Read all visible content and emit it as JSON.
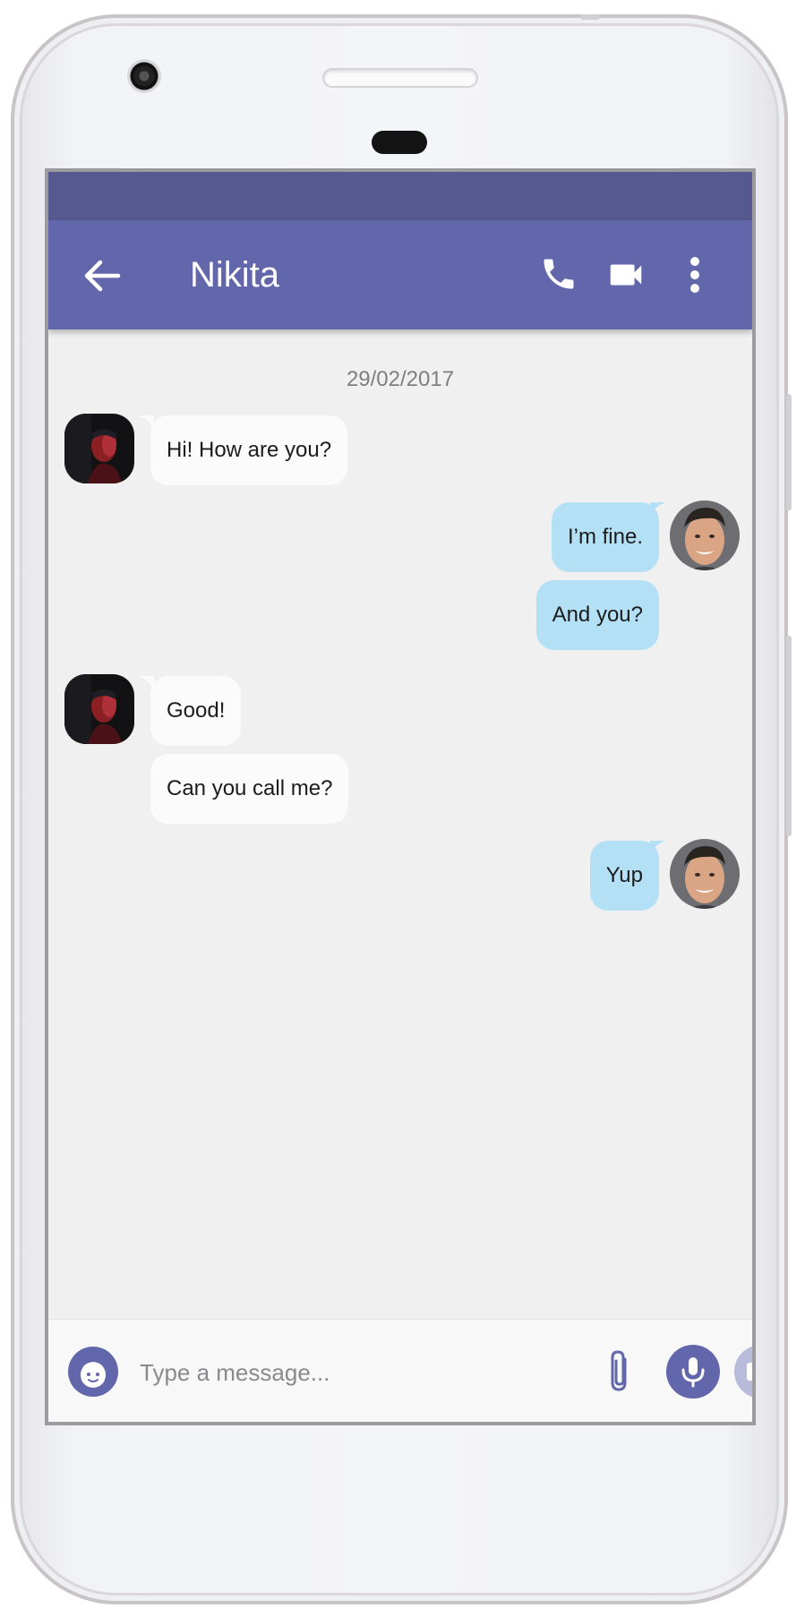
{
  "theme": {
    "status_bar_color": "#56598f",
    "app_bar_color": "#6266ab",
    "incoming_bubble_color": "#fbfbfb",
    "outgoing_bubble_color": "#b4e0f6",
    "chat_background": "#f0f0f1"
  },
  "header": {
    "title": "Nikita",
    "icons": [
      "back-arrow-icon",
      "phone-icon",
      "video-camera-icon",
      "more-vert-icon"
    ]
  },
  "chat": {
    "date": "29/02/2017",
    "messages": [
      {
        "direction": "incoming",
        "text": "Hi! How are you?"
      },
      {
        "direction": "outgoing",
        "text": "I’m fine."
      },
      {
        "direction": "outgoing",
        "text": "And you?"
      },
      {
        "direction": "incoming",
        "text": "Good!"
      },
      {
        "direction": "incoming",
        "text": "Can you call me?"
      },
      {
        "direction": "outgoing",
        "text": "Yup"
      }
    ]
  },
  "composer": {
    "placeholder": "Type a message...",
    "icons": [
      "emoji-face-icon",
      "paperclip-icon",
      "microphone-icon"
    ]
  }
}
